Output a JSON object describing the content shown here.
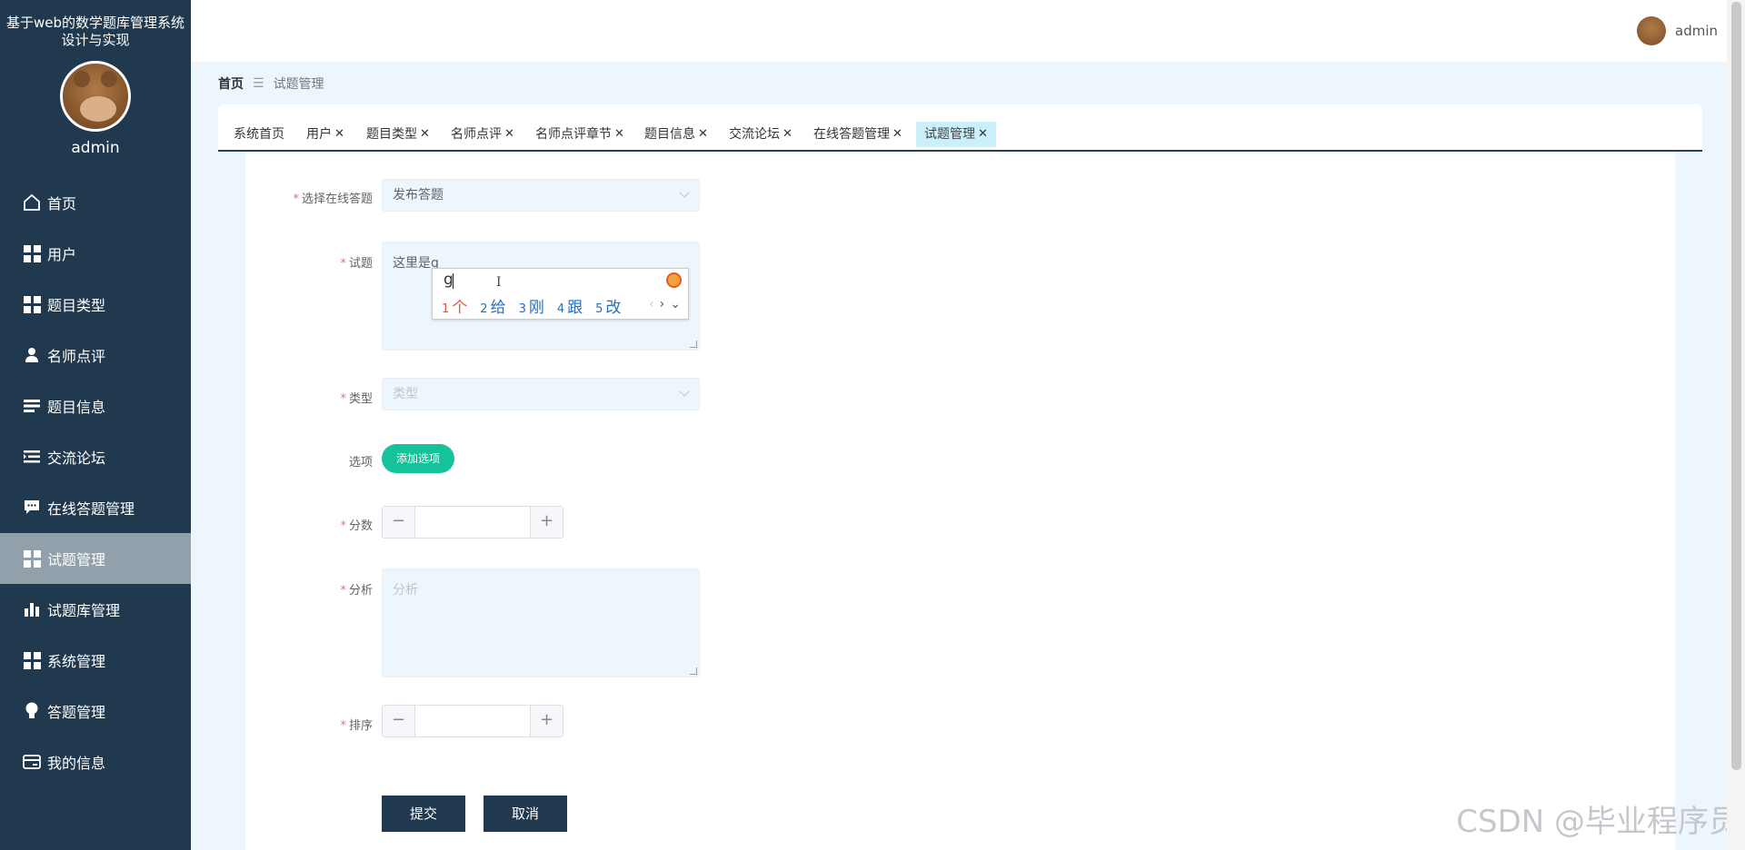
{
  "app": {
    "title": "基于web的数学题库管理系统设计与实现",
    "user": "admin"
  },
  "sidebar": {
    "items": [
      {
        "label": "首页",
        "icon": "home-icon"
      },
      {
        "label": "用户",
        "icon": "grid-icon"
      },
      {
        "label": "题目类型",
        "icon": "grid-icon"
      },
      {
        "label": "名师点评",
        "icon": "person-icon"
      },
      {
        "label": "题目信息",
        "icon": "list-icon"
      },
      {
        "label": "交流论坛",
        "icon": "list-indent-icon"
      },
      {
        "label": "在线答题管理",
        "icon": "chat-icon"
      },
      {
        "label": "试题管理",
        "icon": "grid-icon",
        "active": true
      },
      {
        "label": "试题库管理",
        "icon": "bar-chart-icon"
      },
      {
        "label": "系统管理",
        "icon": "grid-icon"
      },
      {
        "label": "答题管理",
        "icon": "lightbulb-icon"
      },
      {
        "label": "我的信息",
        "icon": "card-icon"
      }
    ]
  },
  "breadcrumb": {
    "home": "首页",
    "separator": "☰",
    "current": "试题管理"
  },
  "tabs": [
    {
      "label": "系统首页",
      "closable": false
    },
    {
      "label": "用户",
      "closable": true
    },
    {
      "label": "题目类型",
      "closable": true
    },
    {
      "label": "名师点评",
      "closable": true
    },
    {
      "label": "名师点评章节",
      "closable": true
    },
    {
      "label": "题目信息",
      "closable": true
    },
    {
      "label": "交流论坛",
      "closable": true
    },
    {
      "label": "在线答题管理",
      "closable": true
    },
    {
      "label": "试题管理",
      "closable": true,
      "active": true
    }
  ],
  "form": {
    "online_exam": {
      "label": "选择在线答题",
      "value": "发布答题"
    },
    "question": {
      "label": "试题",
      "value": "这里是g"
    },
    "type": {
      "label": "类型",
      "placeholder": "类型"
    },
    "options": {
      "label": "选项",
      "add_button": "添加选项"
    },
    "score": {
      "label": "分数",
      "value": ""
    },
    "analysis": {
      "label": "分析",
      "placeholder": "分析"
    },
    "order": {
      "label": "排序",
      "value": ""
    },
    "required_mark": "*",
    "submit_label": "提交",
    "cancel_label": "取消"
  },
  "ime": {
    "composition": "g",
    "candidates": [
      {
        "n": "1",
        "text": "个"
      },
      {
        "n": "2",
        "text": "给"
      },
      {
        "n": "3",
        "text": "刚"
      },
      {
        "n": "4",
        "text": "跟"
      },
      {
        "n": "5",
        "text": "改"
      }
    ]
  },
  "watermark": "CSDN @毕业程序员",
  "colors": {
    "sidebar": "#21394e",
    "accent_green": "#16c29a",
    "active_tab": "#c9f0fb",
    "required": "#f56c6c"
  }
}
